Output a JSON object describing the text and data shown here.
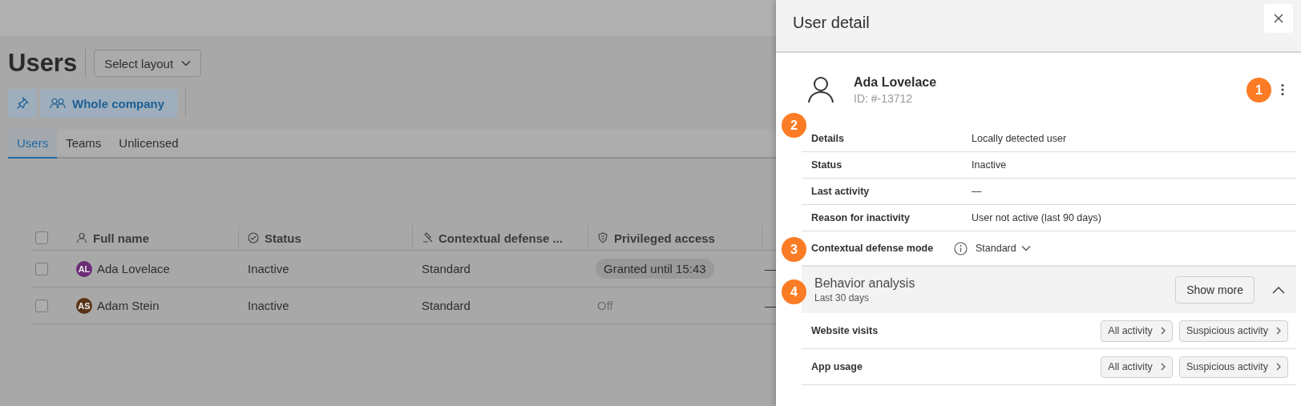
{
  "page": {
    "title": "Users",
    "layout_button": "Select layout",
    "scope_button": "Whole company",
    "tabs": [
      {
        "label": "Users",
        "selected": true
      },
      {
        "label": "Teams",
        "selected": false
      },
      {
        "label": "Unlicensed",
        "selected": false
      }
    ],
    "table": {
      "select_all": false,
      "columns": [
        "Full name",
        "Status",
        "Contextual defense ...",
        "Privileged access"
      ],
      "rows": [
        {
          "selected": false,
          "initials": "AL",
          "color": "#6a2c74",
          "name": "Ada Lovelace",
          "status": "Inactive",
          "mode": "Standard",
          "privileged": {
            "kind": "granted",
            "text": "Granted until 15:43"
          },
          "column_5": "—"
        },
        {
          "selected": false,
          "initials": "AS",
          "color": "#5a3417",
          "name": "Adam Stein",
          "status": "Inactive",
          "mode": "Standard",
          "privileged": {
            "kind": "off",
            "text": "Off"
          },
          "column_5": "—"
        }
      ]
    }
  },
  "detail": {
    "title": "User detail",
    "user": {
      "name": "Ada Lovelace",
      "id": "ID: #-13712"
    },
    "fields": [
      {
        "label": "Details",
        "value": "Locally detected user"
      },
      {
        "label": "Status",
        "value": "Inactive"
      },
      {
        "label": "Last activity",
        "value": "—"
      },
      {
        "label": "Reason for inactivity",
        "value": "User not active (last 90 days)"
      }
    ],
    "mode": {
      "label": "Contextual defense mode",
      "value": "Standard"
    },
    "behavior": {
      "title": "Behavior analysis",
      "subtitle": "Last 30 days",
      "show_more": "Show more",
      "expanded": true,
      "rows": [
        {
          "label": "Website visits",
          "actions": [
            "All activity",
            "Suspicious activity"
          ]
        },
        {
          "label": "App usage",
          "actions": [
            "All activity",
            "Suspicious activity"
          ]
        }
      ]
    }
  },
  "callouts": [
    "1",
    "2",
    "3",
    "4"
  ]
}
